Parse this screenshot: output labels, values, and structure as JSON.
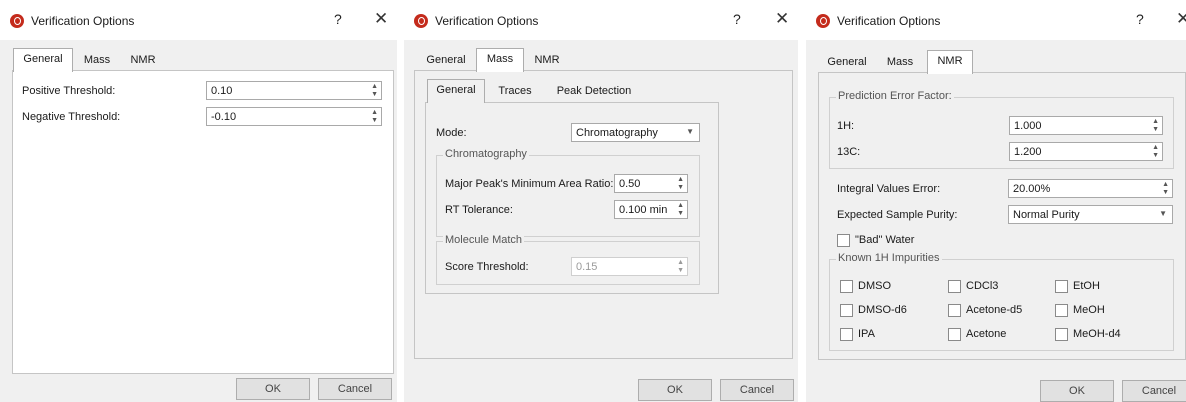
{
  "dialogs": [
    {
      "title": "Verification Options",
      "help": "?",
      "close": "✕",
      "tabs": [
        "General",
        "Mass",
        "NMR"
      ],
      "fields": [
        {
          "label": "Positive Threshold:",
          "value": "0.10"
        },
        {
          "label": "Negative Threshold:",
          "value": "-0.10"
        }
      ],
      "ok": "OK",
      "cancel": "Cancel"
    },
    {
      "title": "Verification Options",
      "help": "?",
      "close": "✕",
      "tabs": [
        "General",
        "Mass",
        "NMR"
      ],
      "subtabs": [
        "General",
        "Traces",
        "Peak Detection"
      ],
      "mode_label": "Mode:",
      "mode_value": "Chromatography",
      "chrom_group": "Chromatography",
      "major_label": "Major Peak's Minimum Area Ratio:",
      "major_value": "0.50",
      "rt_label": "RT Tolerance:",
      "rt_value": "0.100 min",
      "mol_group": "Molecule Match",
      "score_label": "Score Threshold:",
      "score_value": "0.15",
      "ok": "OK",
      "cancel": "Cancel"
    },
    {
      "title": "Verification Options",
      "help": "?",
      "close": "✕",
      "tabs": [
        "General",
        "Mass",
        "NMR"
      ],
      "pef_group": "Prediction Error Factor:",
      "h1_label": "1H:",
      "h1_value": "1.000",
      "c13_label": "13C:",
      "c13_value": "1.200",
      "integral_label": "Integral Values Error:",
      "integral_value": "20.00%",
      "purity_label": "Expected Sample Purity:",
      "purity_value": "Normal Purity",
      "bad_water": "\"Bad\" Water",
      "impurities_group": "Known 1H Impurities",
      "impurities": [
        "DMSO",
        "CDCl3",
        "EtOH",
        "DMSO-d6",
        "Acetone-d5",
        "MeOH",
        "IPA",
        "Acetone",
        "MeOH-d4"
      ],
      "ok": "OK",
      "cancel": "Cancel"
    }
  ]
}
